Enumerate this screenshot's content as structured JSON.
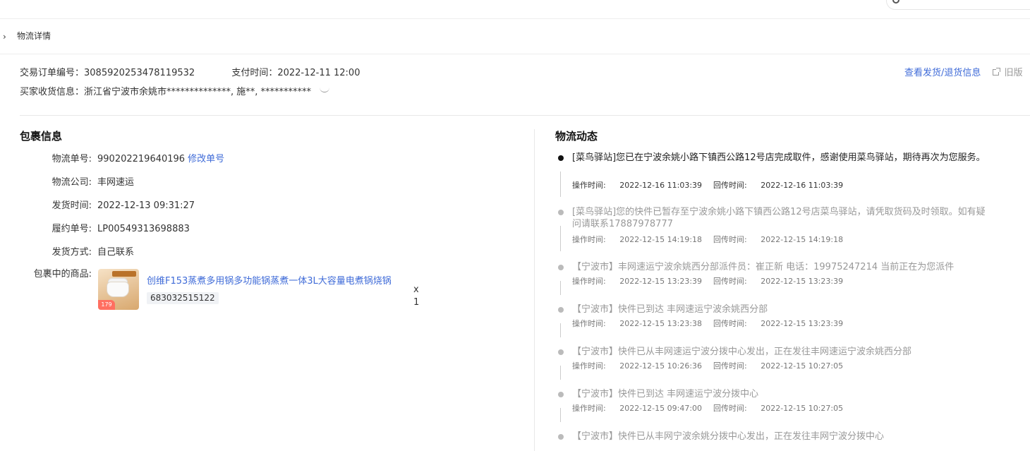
{
  "header": {
    "breadcrumb_title": "物流详情"
  },
  "order": {
    "order_no_label": "交易订单编号：",
    "order_no": "3085920253478119532",
    "pay_time_label": "支付时间：",
    "pay_time": "2022-12-11 12:00",
    "buyer_label": "买家收货信息：",
    "buyer_info": "浙江省宁波市余姚市**************, 施**, ***********"
  },
  "links": {
    "view_shipping": "查看发货/退货信息",
    "old_version": "旧版"
  },
  "package": {
    "title": "包裹信息",
    "fields": [
      {
        "label": "物流单号:",
        "value": "990202219640196"
      },
      {
        "label": "物流公司:",
        "value": "丰网速运"
      },
      {
        "label": "发货时间:",
        "value": "2022-12-13 09:31:27"
      },
      {
        "label": "履约单号:",
        "value": "LP00549313698883"
      },
      {
        "label": "发货方式:",
        "value": "自己联系"
      }
    ],
    "modify_link": "修改单号",
    "goods_label": "包裹中的商品:",
    "goods_name": "创维F153蒸煮多用锅多功能锅蒸煮一体3L大容量电煮锅烧锅",
    "goods_id": "683032515122",
    "goods_qty": "x 1",
    "goods_img_badge": "179"
  },
  "logistics": {
    "title": "物流动态",
    "op_label": "操作时间:",
    "ret_label": "回传时间:",
    "events": [
      {
        "text": "[菜鸟驿站]您已在宁波余姚小路下镇西公路12号店完成取件，感谢使用菜鸟驿站，期待再次为您服务。",
        "op_time": "2022-12-16 11:03:39",
        "ret_time": "2022-12-16 11:03:39"
      },
      {
        "text": "[菜鸟驿站]您的快件已暂存至宁波余姚小路下镇西公路12号店菜鸟驿站，请凭取货码及时领取。如有疑问请联系17887978777",
        "op_time": "2022-12-15 14:19:18",
        "ret_time": "2022-12-15 14:19:18"
      },
      {
        "text": "【宁波市】丰网速运宁波余姚西分部派件员：崔正新 电话：19975247214 当前正在为您派件",
        "op_time": "2022-12-15 13:23:39",
        "ret_time": "2022-12-15 13:23:39"
      },
      {
        "text": "【宁波市】快件已到达 丰网速运宁波余姚西分部",
        "op_time": "2022-12-15 13:23:38",
        "ret_time": "2022-12-15 13:23:39"
      },
      {
        "text": "【宁波市】快件已从丰网速运宁波分拨中心发出，正在发往丰网速运宁波余姚西分部",
        "op_time": "2022-12-15 10:26:36",
        "ret_time": "2022-12-15 10:27:05"
      },
      {
        "text": "【宁波市】快件已到达 丰网速运宁波分拨中心",
        "op_time": "2022-12-15 09:47:00",
        "ret_time": "2022-12-15 10:27:05"
      },
      {
        "text": "【宁波市】快件已从丰网宁波余姚分拨中心发出，正在发往丰网宁波分拨中心",
        "op_time": "",
        "ret_time": ""
      }
    ]
  }
}
